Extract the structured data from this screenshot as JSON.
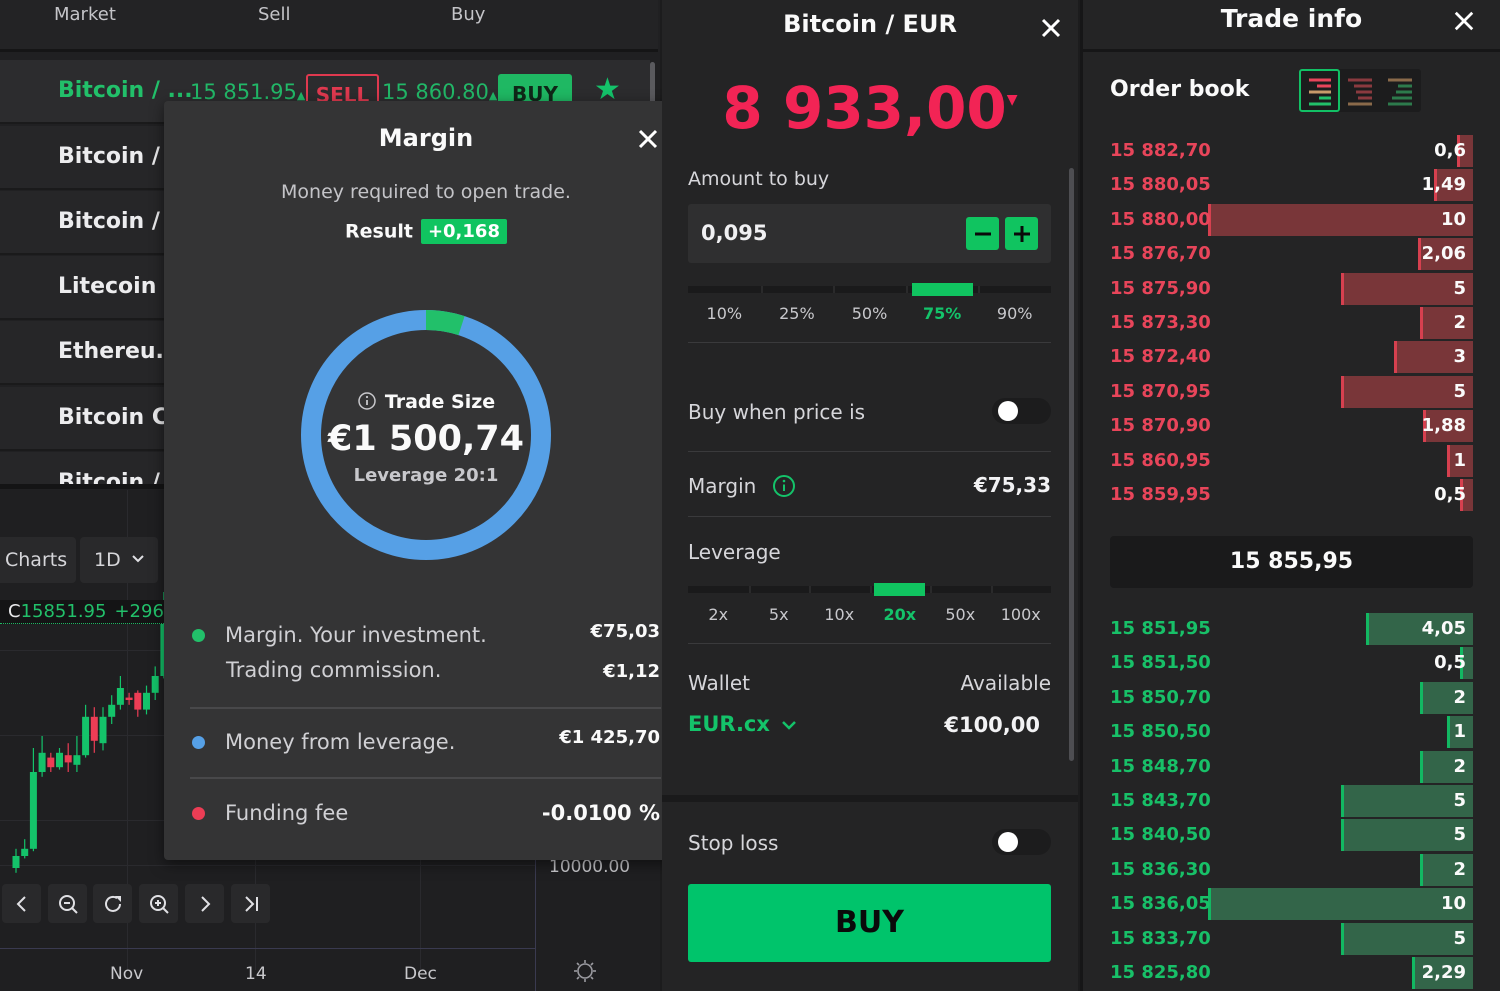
{
  "markets_header": {
    "col_market": "Market",
    "col_sell": "Sell",
    "col_buy": "Buy"
  },
  "markets": [
    {
      "name": "Bitcoin / ...",
      "sell_price": "15 851.95",
      "sell_arrow": "▲",
      "sell_label": "SELL",
      "buy_price": "15 860.80",
      "buy_arrow": "▲",
      "buy_label": "BUY",
      "active": true,
      "favorite": "★"
    },
    {
      "name": "Bitcoin / ..."
    },
    {
      "name": "Bitcoin / ..."
    },
    {
      "name": "Litecoin /..."
    },
    {
      "name": "Ethereu..."
    },
    {
      "name": "Bitcoin C..."
    },
    {
      "name": "Bitcoin / ..."
    }
  ],
  "chart": {
    "charts_label": "Charts",
    "interval": "1D",
    "ohlc_label": "C",
    "ohlc_close": "15851.95",
    "ohlc_change": "+296.",
    "price_tick": "10000.00",
    "x_ticks": [
      "Nov",
      "14",
      "Dec"
    ],
    "candles": [
      {
        "o": 0.3,
        "c": 0.35,
        "h": 0.38,
        "l": 0.28,
        "up": true
      },
      {
        "o": 0.35,
        "c": 0.38,
        "h": 0.42,
        "l": 0.34,
        "up": true
      },
      {
        "o": 0.38,
        "c": 0.7,
        "h": 0.8,
        "l": 0.37,
        "up": true
      },
      {
        "o": 0.7,
        "c": 0.78,
        "h": 0.85,
        "l": 0.68,
        "up": true
      },
      {
        "o": 0.76,
        "c": 0.72,
        "h": 0.78,
        "l": 0.7,
        "up": false
      },
      {
        "o": 0.72,
        "c": 0.78,
        "h": 0.8,
        "l": 0.71,
        "up": true
      },
      {
        "o": 0.77,
        "c": 0.74,
        "h": 0.82,
        "l": 0.7,
        "up": false
      },
      {
        "o": 0.73,
        "c": 0.77,
        "h": 0.85,
        "l": 0.7,
        "up": true
      },
      {
        "o": 0.77,
        "c": 0.93,
        "h": 0.98,
        "l": 0.76,
        "up": true
      },
      {
        "o": 0.93,
        "c": 0.83,
        "h": 0.97,
        "l": 0.78,
        "up": false
      },
      {
        "o": 0.82,
        "c": 0.93,
        "h": 0.97,
        "l": 0.79,
        "up": true
      },
      {
        "o": 0.93,
        "c": 0.98,
        "h": 1.02,
        "l": 0.9,
        "up": true
      },
      {
        "o": 0.98,
        "c": 1.05,
        "h": 1.1,
        "l": 0.96,
        "up": true
      },
      {
        "o": 1.01,
        "c": 1.0,
        "h": 1.03,
        "l": 0.98,
        "up": false
      },
      {
        "o": 1.03,
        "c": 0.96,
        "h": 1.04,
        "l": 0.93,
        "up": false
      },
      {
        "o": 0.96,
        "c": 1.03,
        "h": 1.06,
        "l": 0.94,
        "up": true
      },
      {
        "o": 1.03,
        "c": 1.1,
        "h": 1.14,
        "l": 1.0,
        "up": true
      },
      {
        "o": 1.1,
        "c": 1.4,
        "h": 1.45,
        "l": 1.09,
        "up": true
      }
    ]
  },
  "modal": {
    "title": "Margin",
    "subtitle": "Money required to open trade.",
    "result_label": "Result",
    "result_value": "+0,168",
    "trade_size_label": "Trade Size",
    "trade_size_value": "€1 500,74",
    "leverage_text": "Leverage 20:1",
    "margin_fraction": 0.05,
    "colors": {
      "margin": "#22c06a",
      "leverage": "#56a0e6",
      "funding": "#ec3d55"
    },
    "legend": {
      "margin_label": "Margin. Your investment.",
      "margin_value": "€75,03",
      "commission_label": "Trading commission.",
      "commission_value": "€1,12",
      "leverage_label": "Money from leverage.",
      "leverage_value": "€1 425,70",
      "funding_label": "Funding fee",
      "funding_value": "-0.0100 %"
    }
  },
  "order_form": {
    "title": "Bitcoin / EUR",
    "price": "8 933,00",
    "price_arrow": "▼",
    "amount_label": "Amount to buy",
    "amount_value": "0,095",
    "amount_presets": [
      "10%",
      "25%",
      "50%",
      "75%",
      "90%"
    ],
    "amount_selected": "75%",
    "buy_when_label": "Buy when price is",
    "buy_when_enabled": false,
    "margin_label": "Margin",
    "margin_value": "€75,33",
    "leverage_label": "Leverage",
    "leverage_options": [
      "2x",
      "5x",
      "10x",
      "20x",
      "50x",
      "100x"
    ],
    "leverage_selected": "20x",
    "wallet_label": "Wallet",
    "wallet_value": "EUR.cx",
    "available_label": "Available",
    "available_value": "€100,00",
    "stop_loss_label": "Stop loss",
    "stop_loss_enabled": false,
    "buy_button": "BUY"
  },
  "trade_info": {
    "title": "Trade info",
    "order_book_label": "Order book",
    "view_modes": [
      "both",
      "asks",
      "bids"
    ],
    "view_selected": "both",
    "max_qty": 10,
    "asks": [
      {
        "price": "15 882,70",
        "qty": "0,6",
        "q": 0.6
      },
      {
        "price": "15 880,05",
        "qty": "1,49",
        "q": 1.49
      },
      {
        "price": "15 880,00",
        "qty": "10",
        "q": 10
      },
      {
        "price": "15 876,70",
        "qty": "2,06",
        "q": 2.06
      },
      {
        "price": "15 875,90",
        "qty": "5",
        "q": 5
      },
      {
        "price": "15 873,30",
        "qty": "2",
        "q": 2
      },
      {
        "price": "15 872,40",
        "qty": "3",
        "q": 3
      },
      {
        "price": "15 870,95",
        "qty": "5",
        "q": 5
      },
      {
        "price": "15 870,90",
        "qty": "1,88",
        "q": 1.88
      },
      {
        "price": "15 860,95",
        "qty": "1",
        "q": 1
      },
      {
        "price": "15 859,95",
        "qty": "0,5",
        "q": 0.5
      }
    ],
    "mid_price": "15 855,95",
    "bids": [
      {
        "price": "15 851,95",
        "qty": "4,05",
        "q": 4.05
      },
      {
        "price": "15 851,50",
        "qty": "0,5",
        "q": 0.5
      },
      {
        "price": "15 850,70",
        "qty": "2",
        "q": 2
      },
      {
        "price": "15 850,50",
        "qty": "1",
        "q": 1
      },
      {
        "price": "15 848,70",
        "qty": "2",
        "q": 2
      },
      {
        "price": "15 843,70",
        "qty": "5",
        "q": 5
      },
      {
        "price": "15 840,50",
        "qty": "5",
        "q": 5
      },
      {
        "price": "15 836,30",
        "qty": "2",
        "q": 2
      },
      {
        "price": "15 836,05",
        "qty": "10",
        "q": 10
      },
      {
        "price": "15 833,70",
        "qty": "5",
        "q": 5
      },
      {
        "price": "15 825,80",
        "qty": "2,29",
        "q": 2.29
      }
    ],
    "ask_color": "#e8455a",
    "bid_color": "#18c068"
  }
}
